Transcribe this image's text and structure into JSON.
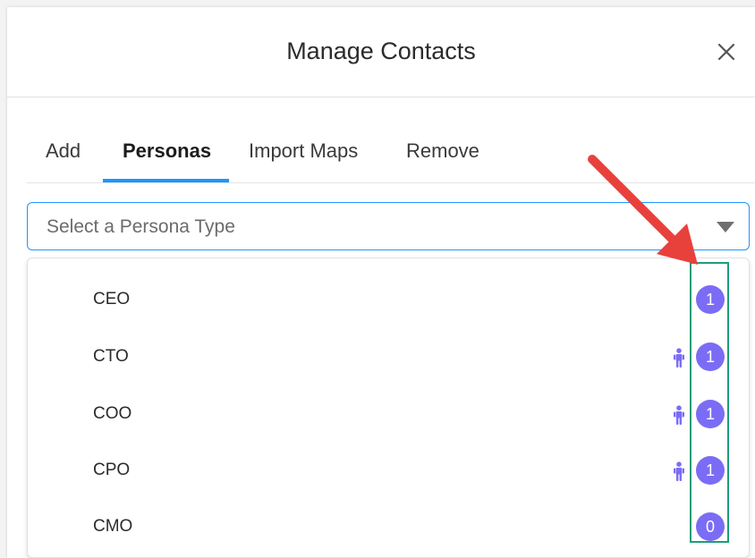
{
  "modal": {
    "title": "Manage Contacts"
  },
  "tabs": [
    {
      "label": "Add",
      "active": false
    },
    {
      "label": "Personas",
      "active": true
    },
    {
      "label": "Import Maps",
      "active": false
    },
    {
      "label": "Remove",
      "active": false
    }
  ],
  "persona_select": {
    "placeholder": "Select a Persona Type"
  },
  "options": [
    {
      "label": "CEO",
      "count": "1",
      "has_person_icon": false
    },
    {
      "label": "CTO",
      "count": "1",
      "has_person_icon": true
    },
    {
      "label": "COO",
      "count": "1",
      "has_person_icon": true
    },
    {
      "label": "CPO",
      "count": "1",
      "has_person_icon": true
    },
    {
      "label": "CMO",
      "count": "0",
      "has_person_icon": false
    }
  ],
  "colors": {
    "accent_blue": "#1b96ff",
    "badge_purple": "#7b6cf6",
    "annotation_red": "#e8413c",
    "annotation_green": "#1f9c7a"
  },
  "icons": {
    "close": "close-icon",
    "caret": "caret-down-icon",
    "person": "person-icon",
    "arrow": "annotation-arrow"
  }
}
